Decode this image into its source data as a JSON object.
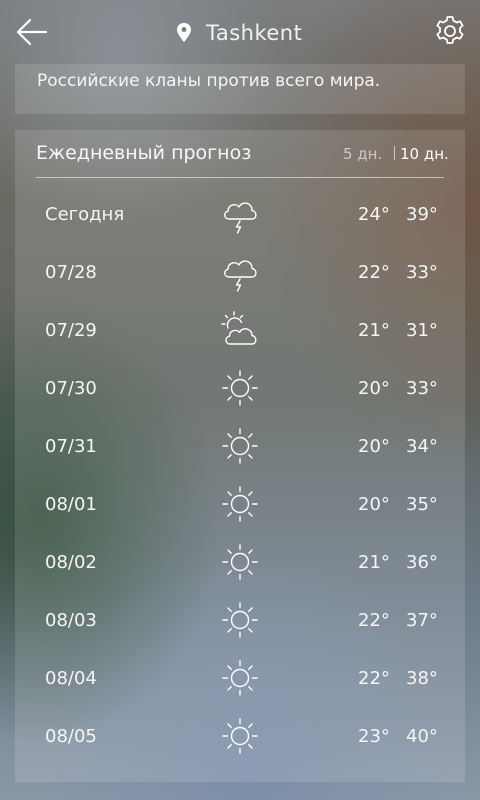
{
  "header": {
    "city": "Tashkent",
    "back_icon": "back-arrow-icon",
    "location_icon": "location-pin-icon",
    "settings_icon": "gear-icon"
  },
  "news": {
    "headline": "Российские кланы против всего мира."
  },
  "forecast": {
    "title": "Ежедневный прогноз",
    "toggle_5": "5 дн.",
    "toggle_10": "10 дн.",
    "selected_toggle": "10 дн.",
    "days": [
      {
        "date": "Сегодня",
        "icon": "thunderstorm",
        "low": "24°",
        "high": "39°"
      },
      {
        "date": "07/28",
        "icon": "thunderstorm",
        "low": "22°",
        "high": "33°"
      },
      {
        "date": "07/29",
        "icon": "partly-cloudy",
        "low": "21°",
        "high": "31°"
      },
      {
        "date": "07/30",
        "icon": "sunny",
        "low": "20°",
        "high": "33°"
      },
      {
        "date": "07/31",
        "icon": "sunny",
        "low": "20°",
        "high": "34°"
      },
      {
        "date": "08/01",
        "icon": "sunny",
        "low": "20°",
        "high": "35°"
      },
      {
        "date": "08/02",
        "icon": "sunny",
        "low": "21°",
        "high": "36°"
      },
      {
        "date": "08/03",
        "icon": "sunny",
        "low": "22°",
        "high": "37°"
      },
      {
        "date": "08/04",
        "icon": "sunny",
        "low": "22°",
        "high": "38°"
      },
      {
        "date": "08/05",
        "icon": "sunny",
        "low": "23°",
        "high": "40°"
      }
    ]
  }
}
